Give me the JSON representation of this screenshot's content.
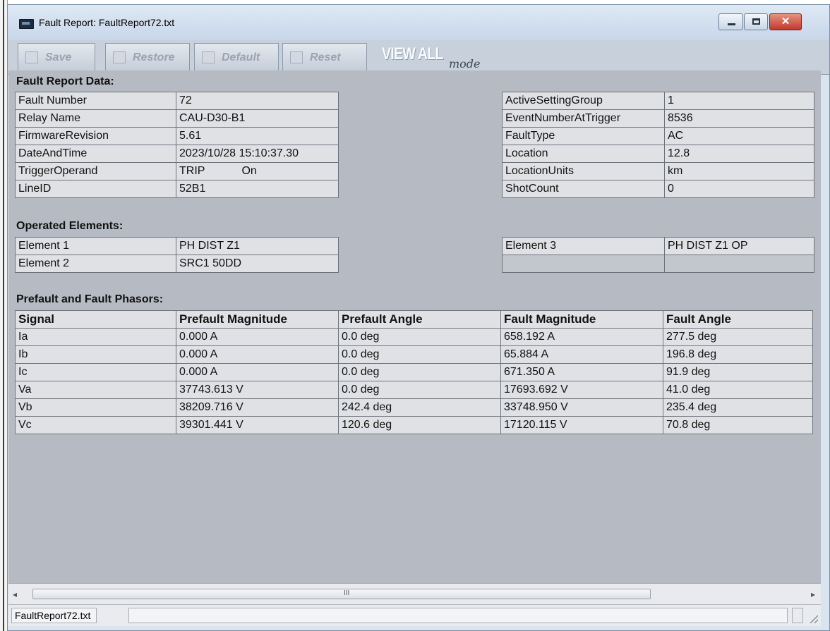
{
  "window": {
    "title": "Fault Report: FaultReport72.txt",
    "minimize_icon": "minimize-icon",
    "maximize_icon": "maximize-icon",
    "close_icon": "close-icon",
    "close_glyph": "✕"
  },
  "toolbar": {
    "save_label": "Save",
    "restore_label": "Restore",
    "default_label": "Default",
    "reset_label": "Reset",
    "viewall_label": "VIEW ALL",
    "mode_label": "mode"
  },
  "fault_report": {
    "heading": "Fault Report Data:",
    "left": [
      {
        "label": "Fault Number",
        "value": "72"
      },
      {
        "label": "Relay Name",
        "value": "CAU-D30-B1"
      },
      {
        "label": "FirmwareRevision",
        "value": "5.61"
      },
      {
        "label": "DateAndTime",
        "value": "2023/10/28 15:10:37.30"
      },
      {
        "label": "TriggerOperand",
        "value": "TRIP",
        "value2": "On"
      },
      {
        "label": "LineID",
        "value": "52B1"
      }
    ],
    "right": [
      {
        "label": "ActiveSettingGroup",
        "value": "1"
      },
      {
        "label": "EventNumberAtTrigger",
        "value": "8536"
      },
      {
        "label": "FaultType",
        "value": "AC"
      },
      {
        "label": "Location",
        "value": "12.8"
      },
      {
        "label": "LocationUnits",
        "value": "km"
      },
      {
        "label": "ShotCount",
        "value": "0"
      }
    ]
  },
  "operated_elements": {
    "heading": "Operated Elements:",
    "left": [
      {
        "label": "Element 1",
        "value": "PH DIST Z1"
      },
      {
        "label": "Element 2",
        "value": "SRC1 50DD"
      }
    ],
    "right": [
      {
        "label": "Element 3",
        "value": "PH DIST Z1 OP"
      },
      {
        "label": "",
        "value": ""
      }
    ]
  },
  "phasors": {
    "heading": "Prefault and Fault Phasors:",
    "columns": [
      "Signal",
      "Prefault Magnitude",
      "Prefault Angle",
      "Fault Magnitude",
      "Fault Angle"
    ],
    "rows": [
      [
        "Ia",
        "0.000 A",
        "0.0 deg",
        "658.192 A",
        "277.5 deg"
      ],
      [
        "Ib",
        "0.000 A",
        "0.0 deg",
        "65.884 A",
        "196.8 deg"
      ],
      [
        "Ic",
        "0.000 A",
        "0.0 deg",
        "671.350 A",
        "91.9 deg"
      ],
      [
        "Va",
        "37743.613 V",
        "0.0 deg",
        "17693.692 V",
        "41.0 deg"
      ],
      [
        "Vb",
        "38209.716 V",
        "242.4 deg",
        "33748.950 V",
        "235.4 deg"
      ],
      [
        "Vc",
        "39301.441 V",
        "120.6 deg",
        "17120.115 V",
        "70.8 deg"
      ]
    ]
  },
  "scrollbar": {
    "left_arrow": "◂",
    "right_arrow": "▸",
    "grip": "III"
  },
  "status": {
    "filename": "FaultReport72.txt"
  }
}
